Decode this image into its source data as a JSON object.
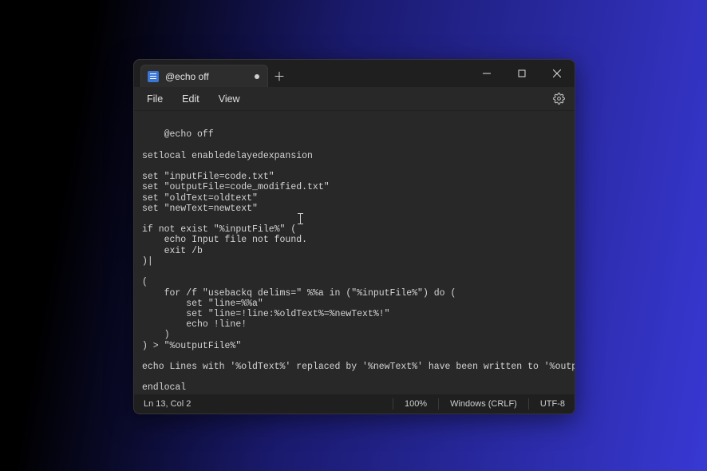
{
  "tab": {
    "title": "@echo off",
    "dirty": true
  },
  "menu": {
    "file": "File",
    "edit": "Edit",
    "view": "View"
  },
  "editor": {
    "content": "@echo off\n\nsetlocal enabledelayedexpansion\n\nset \"inputFile=code.txt\"\nset \"outputFile=code_modified.txt\"\nset \"oldText=oldtext\"\nset \"newText=newtext\"\n\nif not exist \"%inputFile%\" (\n    echo Input file not found.\n    exit /b\n)|\n\n(\n    for /f \"usebackq delims=\" %%a in (\"%inputFile%\") do (\n        set \"line=%%a\"\n        set \"line=!line:%oldText%=%newText%!\"\n        echo !line!\n    )\n) > \"%outputFile%\"\n\necho Lines with '%oldText%' replaced by '%newText%' have been written to '%outputFile%'.\n\nendlocal"
  },
  "statusbar": {
    "position": "Ln 13, Col 2",
    "zoom": "100%",
    "line_ending": "Windows (CRLF)",
    "encoding": "UTF-8"
  }
}
